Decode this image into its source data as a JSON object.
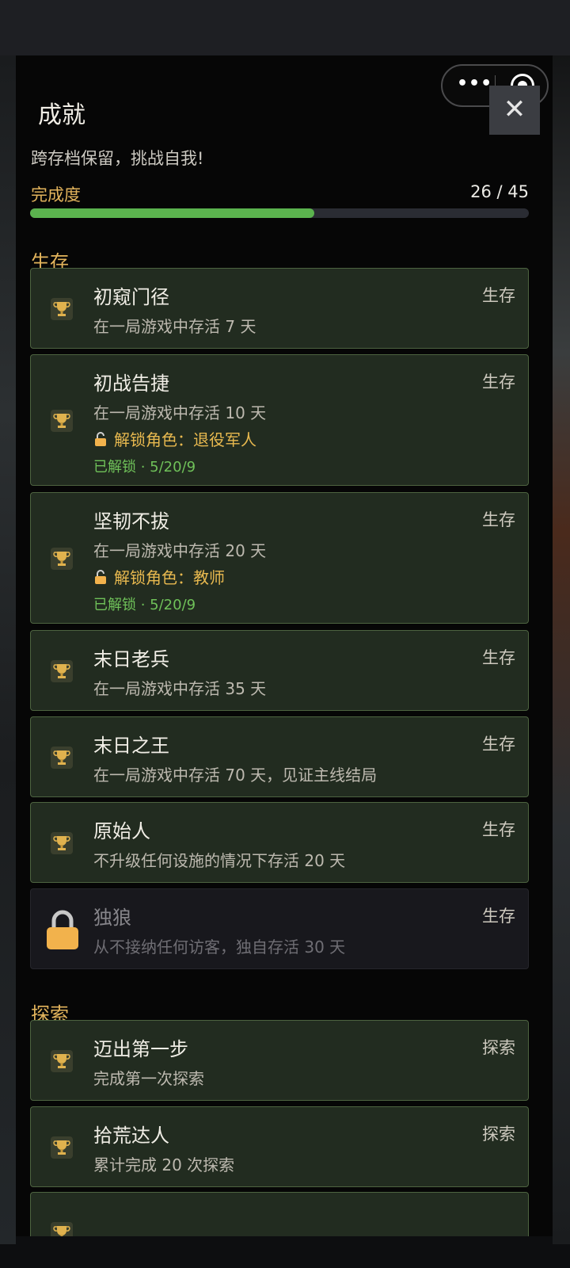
{
  "header": {
    "title": "成就",
    "subtitle": "跨存档保留，挑战自我!",
    "close_glyph": "✕"
  },
  "capsule": {
    "more_glyph": "•••"
  },
  "progress": {
    "label": "完成度",
    "count": "26 / 45",
    "fraction": 0.57
  },
  "sections": [
    {
      "title": "生存",
      "items": [
        {
          "name": "初窥门径",
          "category": "生存",
          "desc": "在一局游戏中存活 7 天",
          "locked": false
        },
        {
          "name": "初战告捷",
          "category": "生存",
          "desc": "在一局游戏中存活 10 天",
          "reward": "解锁角色：退役军人",
          "unlocked": "已解锁 · 5/20/9",
          "locked": false
        },
        {
          "name": "坚韧不拔",
          "category": "生存",
          "desc": "在一局游戏中存活 20 天",
          "reward": "解锁角色：教师",
          "unlocked": "已解锁 · 5/20/9",
          "locked": false
        },
        {
          "name": "末日老兵",
          "category": "生存",
          "desc": "在一局游戏中存活 35 天",
          "locked": false
        },
        {
          "name": "末日之王",
          "category": "生存",
          "desc": "在一局游戏中存活 70 天，见证主线结局",
          "locked": false
        },
        {
          "name": "原始人",
          "category": "生存",
          "desc": "不升级任何设施的情况下存活 20 天",
          "locked": false
        },
        {
          "name": "独狼",
          "category": "生存",
          "desc": "从不接纳任何访客，独自存活 30 天",
          "locked": true
        }
      ]
    },
    {
      "title": "探索",
      "items": [
        {
          "name": "迈出第一步",
          "category": "探索",
          "desc": "完成第一次探索",
          "locked": false
        },
        {
          "name": "拾荒达人",
          "category": "探索",
          "desc": "累计完成 20 次探索",
          "locked": false
        },
        {
          "name": "",
          "category": "",
          "desc": "",
          "locked": false
        }
      ]
    }
  ],
  "colors": {
    "accent": "#e3b45c",
    "progress": "#5bb34e",
    "card_bg": "#222c20",
    "card_border": "#4d6340",
    "unlocked": "#6fc159"
  }
}
